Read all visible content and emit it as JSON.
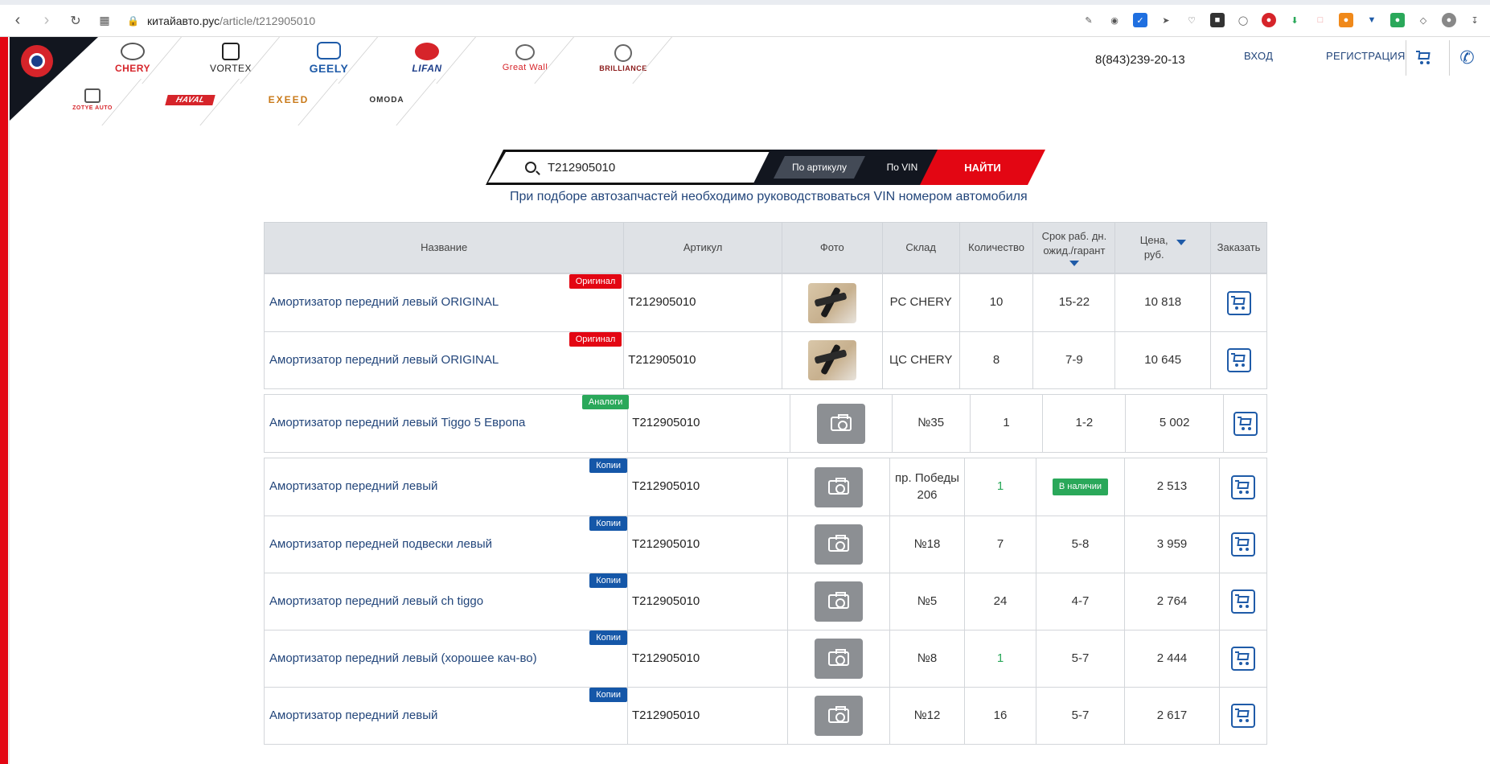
{
  "browser": {
    "url_host": "китайавто.рус",
    "url_path": "/article/t212905010"
  },
  "header": {
    "brands_row1": [
      {
        "name": "CHERY",
        "color": "#d6242a"
      },
      {
        "name": "VORTEX",
        "color": "#222222"
      },
      {
        "name": "GEELY",
        "color": "#1f5ba8"
      },
      {
        "name": "LIFAN",
        "color": "#1f3f8a"
      },
      {
        "name": "Great Wall",
        "color": "#d6242a"
      },
      {
        "name": "BRILLIANCE",
        "color": "#8b1a1a"
      }
    ],
    "brands_row2": [
      {
        "name": "ZOTYE AUTO",
        "color": "#d6242a"
      },
      {
        "name": "HAVAL",
        "color": "#d6242a"
      },
      {
        "name": "EXEED",
        "color": "#c97a1a"
      },
      {
        "name": "OMODA",
        "color": "#333333"
      }
    ],
    "phone": "8(843)239-20-13",
    "login": "ВХОД",
    "register": "РЕГИСТРАЦИЯ"
  },
  "search": {
    "value": "T212905010",
    "mode_article": "По артикулу",
    "mode_vin": "По VIN",
    "find": "НАЙТИ",
    "hint": "При подборе автозапчастей необходимо руководствоваться VIN номером автомобиля"
  },
  "table": {
    "columns": {
      "name": "Название",
      "article": "Артикул",
      "photo": "Фото",
      "stock": "Склад",
      "qty": "Количество",
      "term_l1": "Срок раб. дн.",
      "term_l2": "ожид./гарант",
      "price_l1": "Цена,",
      "price_l2": "руб.",
      "order": "Заказать"
    },
    "groups": [
      {
        "badge": "Оригинал",
        "rows": [
          {
            "name": "Амортизатор передний левый ORIGINAL",
            "article": "T212905010",
            "photo": true,
            "stock": "РС CHERY",
            "qty": "10",
            "term": "15-22",
            "price": "10 818"
          },
          {
            "name": "Амортизатор передний левый ORIGINAL",
            "article": "T212905010",
            "photo": true,
            "stock": "ЦС CHERY",
            "qty": "8",
            "term": "7-9",
            "price": "10 645"
          }
        ]
      },
      {
        "badge": "Аналоги",
        "rows": [
          {
            "name": "Амортизатор передний левый Tiggo 5 Европа",
            "article": "T212905010",
            "photo": false,
            "stock": "№35",
            "qty": "1",
            "term": "1-2",
            "price": "5 002"
          }
        ]
      },
      {
        "badge": "Копии",
        "rows": [
          {
            "name": "Амортизатор передний левый",
            "article": "T212905010",
            "photo": false,
            "stock": "пр. Победы 206",
            "qty": "1",
            "term": "В наличии",
            "price": "2 513"
          },
          {
            "name": "Амортизатор передней подвески левый",
            "article": "T212905010",
            "photo": false,
            "stock": "№18",
            "qty": "7",
            "term": "5-8",
            "price": "3 959"
          },
          {
            "name": "Амортизатор передний левый ch tiggo",
            "article": "T212905010",
            "photo": false,
            "stock": "№5",
            "qty": "24",
            "term": "4-7",
            "price": "2 764"
          },
          {
            "name": "Амортизатор передний левый (хорошее кач-во)",
            "article": "T212905010",
            "photo": false,
            "stock": "№8",
            "qty": "1",
            "term": "5-7",
            "price": "2 444"
          },
          {
            "name": "Амортизатор передний левый",
            "article": "T212905010",
            "photo": false,
            "stock": "№12",
            "qty": "16",
            "term": "5-7",
            "price": "2 617"
          }
        ]
      }
    ]
  },
  "colors": {
    "accent_red": "#e30613",
    "link_blue": "#23467b",
    "analog_green": "#2aa85a",
    "copy_blue": "#1557a8"
  }
}
